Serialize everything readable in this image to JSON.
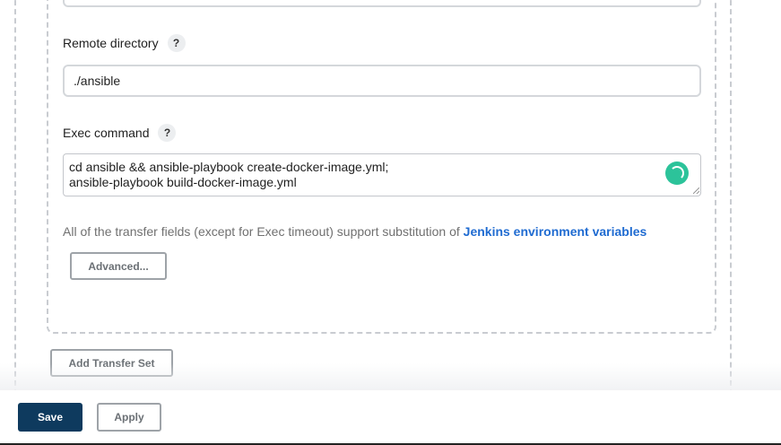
{
  "remote_directory": {
    "label": "Remote directory",
    "help": "?",
    "value": "./ansible"
  },
  "exec_command": {
    "label": "Exec command",
    "help": "?",
    "value": "cd ansible && ansible-playbook create-docker-image.yml;\nansible-playbook build-docker-image.yml"
  },
  "substitution_note": {
    "text": "All of the transfer fields (except for Exec timeout) support substitution of ",
    "link": "Jenkins environment variables"
  },
  "buttons": {
    "advanced": "Advanced...",
    "add_transfer_set": "Add Transfer Set",
    "save": "Save",
    "apply": "Apply"
  },
  "colors": {
    "primary": "#0e3a5e",
    "link": "#1f6bd1",
    "spinner": "#2cc39a"
  },
  "icons": {
    "help": "question-mark-icon",
    "grammar": "spinner-icon"
  }
}
